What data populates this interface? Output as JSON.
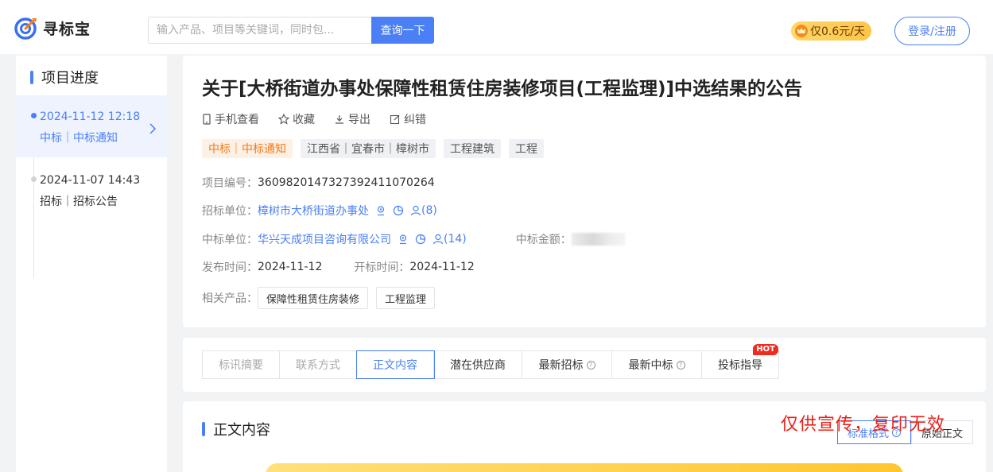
{
  "header": {
    "logo_text": "寻标宝",
    "search_placeholder": "输入产品、项目等关键词，同时包...",
    "search_button": "查询一下",
    "price_badge": "仅0.6元/天",
    "login_button": "登录/注册",
    "accent_color": "#4a7ff5"
  },
  "sidebar": {
    "title": "项目进度",
    "items": [
      {
        "date": "2024-11-12 12:18",
        "type": "中标｜中标通知",
        "active": true
      },
      {
        "date": "2024-11-07 14:43",
        "type": "招标｜招标公告",
        "active": false
      }
    ]
  },
  "detail": {
    "title": "关于[大桥街道办事处保障性租赁住房装修项目(工程监理)]中选结果的公告",
    "actions": [
      "手机查看",
      "收藏",
      "导出",
      "纠错"
    ],
    "tags": [
      "中标｜中标通知",
      "江西省｜宜春市｜樟树市",
      "工程建筑",
      "工程"
    ],
    "project_no_label": "项目编号：",
    "project_no": "3609820147327392411070264",
    "tenderer_label": "招标单位：",
    "tenderer": "樟树市大桥街道办事处",
    "tenderer_contacts": "(8)",
    "winner_label": "中标单位：",
    "winner": "华兴天成项目咨询有限公司",
    "winner_contacts": "(14)",
    "amount_label": "中标金额：",
    "publish_label": "发布时间：",
    "publish_date": "2024-11-12",
    "open_label": "开标时间：",
    "open_date": "2024-11-12",
    "products_label": "相关产品：",
    "products": [
      "保障性租赁住房装修",
      "工程监理"
    ]
  },
  "tabs": {
    "items": [
      "标讯摘要",
      "联系方式",
      "正文内容",
      "潜在供应商",
      "最新招标",
      "最新中标",
      "投标指导"
    ],
    "hot_label": "HOT"
  },
  "content": {
    "title": "正文内容",
    "format_standard": "标准格式",
    "format_original": "原始正文",
    "watermark": "仅供宣传，复印无效"
  }
}
